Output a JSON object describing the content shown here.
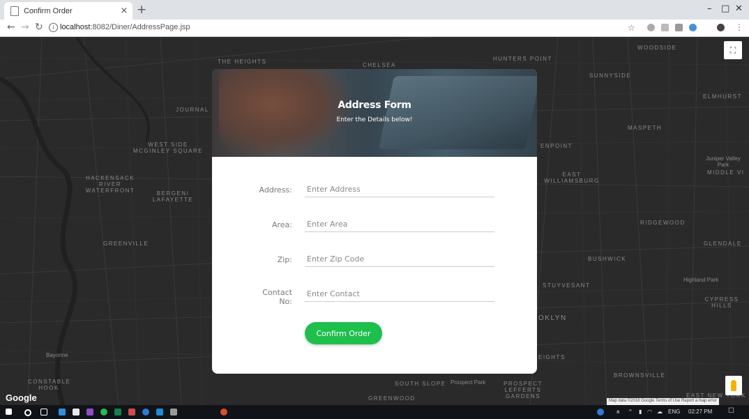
{
  "browser": {
    "tab_title": "Confirm Order",
    "tab_close": "×",
    "new_tab": "+",
    "url_host": "localhost",
    "url_rest": ":8082/Diner/AddressPage.jsp",
    "minimize": "–",
    "maximize": "□",
    "close": "✕"
  },
  "map": {
    "labels": [
      "THE HEIGHTS",
      "CHELSEA",
      "HUNTERS POINT",
      "WOODSIDE",
      "SUNNYSIDE",
      "ELMHURST",
      "JOURNAL S",
      "MASPETH",
      "WEST SIDE MCGINLEY SQUARE",
      "ENPOINT",
      "EAST WILLIAMSBURG",
      "HACKENSACK RIVER WATERFRONT",
      "BERGEN/ LAFAYETTE",
      "MIDDLE VI",
      "RIDGEWOOD",
      "GREENVILLE",
      "GLENDALE",
      "BUSHWICK",
      "STUYVESANT",
      "Highland Park",
      "CYPRESS HILLS",
      "Bayonne",
      "OKLYN",
      "EIGHTS",
      "BROWNSVILLE",
      "CONSTABLE HOOK",
      "SOUTH SLOPE",
      "Prospect Park",
      "PROSPECT LEFFERTS GARDENS",
      "GREENWOOD",
      "EAST NEW YORK",
      "Juniper Valley Park"
    ],
    "google": "Google",
    "attribution": "Map data ©2018 Google   Terms of Use   Report a map error"
  },
  "form": {
    "title": "Address Form",
    "subtitle": "Enter the Details below!",
    "address_label": "Address:",
    "address_placeholder": "Enter Address",
    "area_label": "Area:",
    "area_placeholder": "Enter Area",
    "zip_label": "Zip:",
    "zip_placeholder": "Enter Zip Code",
    "contact_label": "Contact No:",
    "contact_placeholder": "Enter Contact",
    "submit_label": "Confirm Order",
    "accent_color": "#1fbf4e"
  },
  "taskbar": {
    "language": "ENG",
    "time": "02:27 PM"
  }
}
